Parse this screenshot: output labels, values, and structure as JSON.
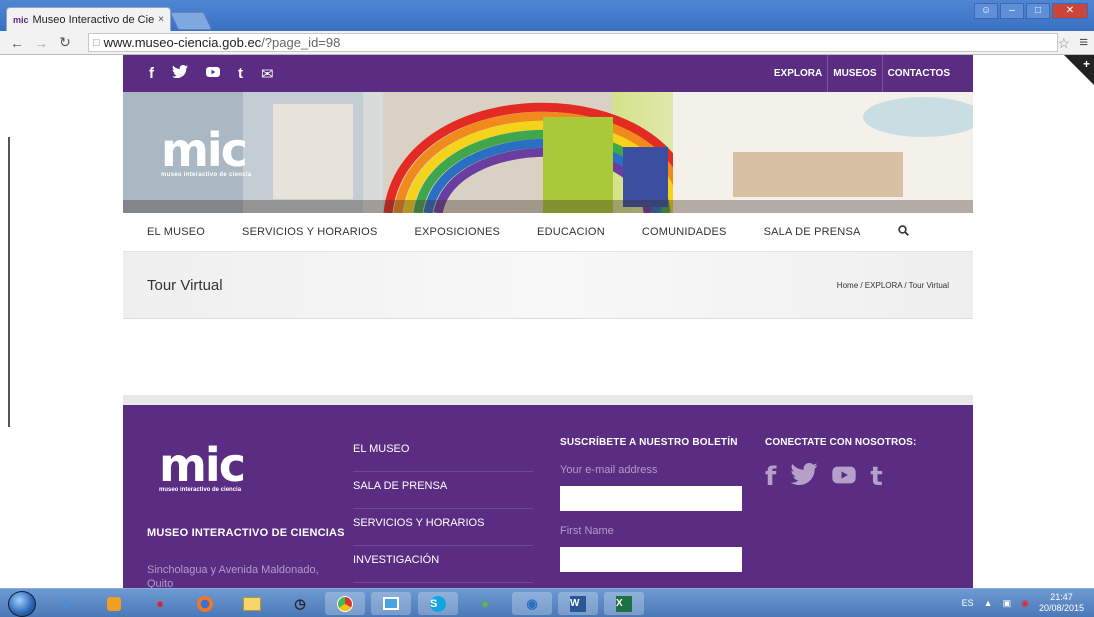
{
  "browser": {
    "tab_title": "Museo Interactivo de Cier",
    "tab_favicon": "mic",
    "tab_close": "×",
    "url_domain": "www.museo-ciencia.gob.ec",
    "url_path": "/?page_id=98"
  },
  "site": {
    "social_icons": [
      "f",
      "t",
      "▶",
      "t",
      "✉"
    ],
    "top_nav": [
      "EXPLORA",
      "MUSEOS",
      "CONTACTOS"
    ],
    "logo_text": "mic",
    "logo_sub": "museo interactivo de ciencia",
    "main_nav": [
      "EL MUSEO",
      "SERVICIOS Y HORARIOS",
      "EXPOSICIONES",
      "EDUCACION",
      "COMUNIDADES",
      "SALA DE PRENSA"
    ],
    "page_title": "Tour Virtual",
    "breadcrumb": "Home / EXPLORA / Tour Virtual"
  },
  "footer": {
    "logo_text": "mic",
    "logo_sub": "museo interactivo de ciencia",
    "org_name": "MUSEO INTERACTIVO DE CIENCIAS",
    "address": "Sincholagua y Avenida Maldonado, Quito",
    "links": [
      "EL MUSEO",
      "SALA DE PRENSA",
      "SERVICIOS Y HORARIOS",
      "INVESTIGACIÓN"
    ],
    "newsletter_heading": "SUSCRÍBETE A NUESTRO BOLETÍN",
    "email_label": "Your e-mail address",
    "firstname_label": "First Name",
    "connect_heading": "CONECTATE CON NOSOTROS:",
    "connect_icons": [
      "f",
      "t",
      "▶",
      "t"
    ]
  },
  "taskbar": {
    "language": "ES",
    "time": "21:47",
    "date": "20/08/2015"
  },
  "colors": {
    "brand_purple": "#5a2d82",
    "footer_muted": "#b29ac8"
  }
}
